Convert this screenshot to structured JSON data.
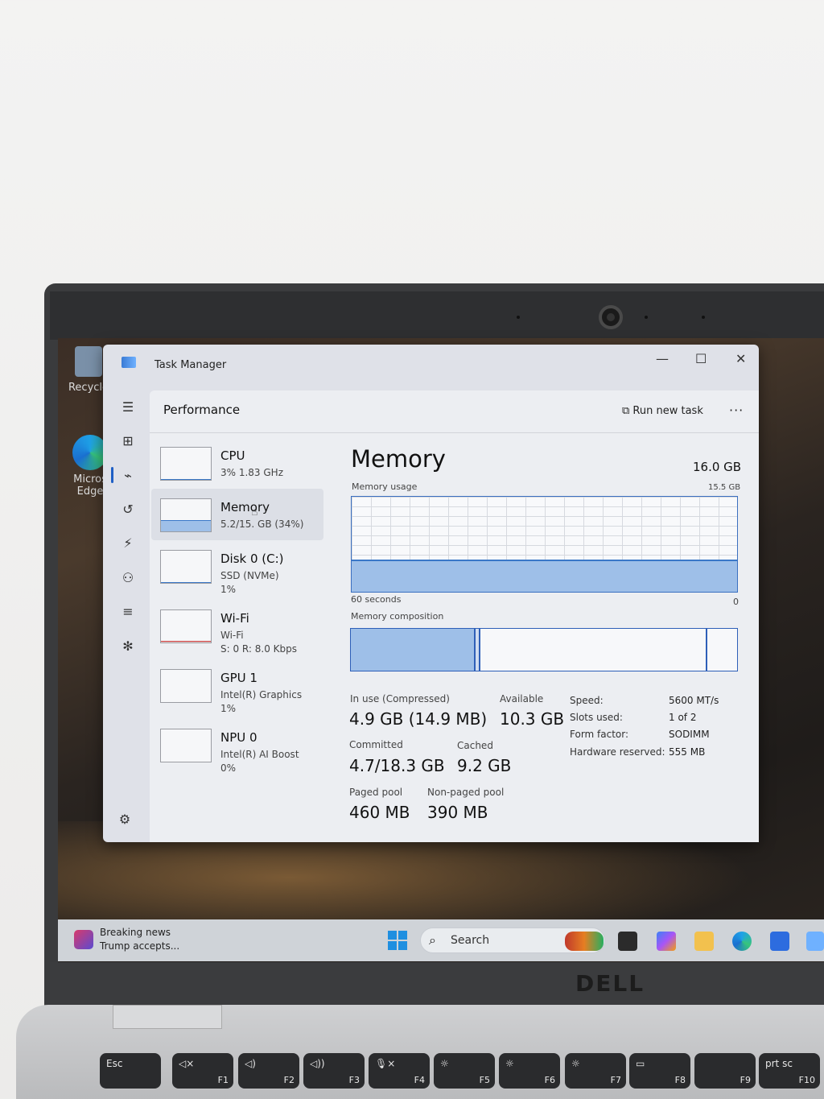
{
  "window": {
    "title": "Task Manager",
    "minimize": "—",
    "maximize": "☐",
    "close": "✕"
  },
  "header": {
    "title": "Performance",
    "run_task": "Run new task",
    "more": "···"
  },
  "desktop": {
    "recycle": "Recycle",
    "edge_line1": "Micros",
    "edge_line2": "Edge"
  },
  "devices": [
    {
      "name": "CPU",
      "line1": "3%  1.83 GHz",
      "line2": ""
    },
    {
      "name": "Memory",
      "line1": "5.2/15.  GB (34%)",
      "line2": ""
    },
    {
      "name": "Disk 0 (C:)",
      "line1": "SSD (NVMe)",
      "line2": "1%"
    },
    {
      "name": "Wi-Fi",
      "line1": "Wi-Fi",
      "line2": "S: 0  R: 8.0 Kbps"
    },
    {
      "name": "GPU 1",
      "line1": "Intel(R) Graphics",
      "line2": "1%"
    },
    {
      "name": "NPU 0",
      "line1": "Intel(R) AI Boost",
      "line2": "0%"
    }
  ],
  "memory": {
    "title": "Memory",
    "total": "16.0 GB",
    "usage_label": "Memory usage",
    "usage_max": "15.5 GB",
    "time_label": "60 seconds",
    "zero": "0",
    "composition_label": "Memory composition",
    "usage_fraction": 0.34,
    "stats": {
      "in_use_label": "In use (Compressed)",
      "in_use_value": "4.9 GB (14.9 MB)",
      "available_label": "Available",
      "available_value": "10.3 GB",
      "committed_label": "Committed",
      "committed_value": "4.7/18.3 GB",
      "cached_label": "Cached",
      "cached_value": "9.2 GB",
      "paged_label": "Paged pool",
      "paged_value": "460 MB",
      "nonpaged_label": "Non-paged pool",
      "nonpaged_value": "390 MB"
    },
    "props": {
      "speed_label": "Speed:",
      "speed_value": "5600 MT/s",
      "slots_label": "Slots used:",
      "slots_value": "1 of 2",
      "form_label": "Form factor:",
      "form_value": "SODIMM",
      "hw_label": "Hardware reserved:",
      "hw_value": "555 MB"
    }
  },
  "taskbar": {
    "news_title": "Breaking news",
    "news_sub": "Trump accepts...",
    "search": "Search"
  },
  "brand": "DELL",
  "keys": [
    {
      "label": "Esc",
      "fn": ""
    },
    {
      "label": "◁×",
      "fn": "F1"
    },
    {
      "label": "◁)",
      "fn": "F2"
    },
    {
      "label": "◁))",
      "fn": "F3"
    },
    {
      "label": "🎙×",
      "fn": "F4"
    },
    {
      "label": "☼",
      "fn": "F5"
    },
    {
      "label": "☼",
      "fn": "F6"
    },
    {
      "label": "☼",
      "fn": "F7"
    },
    {
      "label": "▭",
      "fn": "F8"
    },
    {
      "label": "",
      "fn": "F9"
    },
    {
      "label": "prt sc",
      "fn": "F10"
    }
  ]
}
